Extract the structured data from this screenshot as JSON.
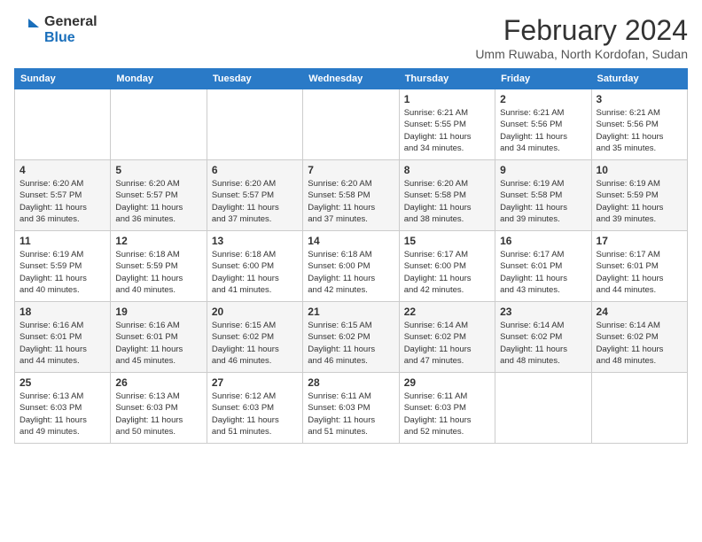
{
  "header": {
    "logo_general": "General",
    "logo_blue": "Blue",
    "month_title": "February 2024",
    "location": "Umm Ruwaba, North Kordofan, Sudan"
  },
  "weekdays": [
    "Sunday",
    "Monday",
    "Tuesday",
    "Wednesday",
    "Thursday",
    "Friday",
    "Saturday"
  ],
  "weeks": [
    [
      {
        "day": "",
        "info": ""
      },
      {
        "day": "",
        "info": ""
      },
      {
        "day": "",
        "info": ""
      },
      {
        "day": "",
        "info": ""
      },
      {
        "day": "1",
        "info": "Sunrise: 6:21 AM\nSunset: 5:55 PM\nDaylight: 11 hours\nand 34 minutes."
      },
      {
        "day": "2",
        "info": "Sunrise: 6:21 AM\nSunset: 5:56 PM\nDaylight: 11 hours\nand 34 minutes."
      },
      {
        "day": "3",
        "info": "Sunrise: 6:21 AM\nSunset: 5:56 PM\nDaylight: 11 hours\nand 35 minutes."
      }
    ],
    [
      {
        "day": "4",
        "info": "Sunrise: 6:20 AM\nSunset: 5:57 PM\nDaylight: 11 hours\nand 36 minutes."
      },
      {
        "day": "5",
        "info": "Sunrise: 6:20 AM\nSunset: 5:57 PM\nDaylight: 11 hours\nand 36 minutes."
      },
      {
        "day": "6",
        "info": "Sunrise: 6:20 AM\nSunset: 5:57 PM\nDaylight: 11 hours\nand 37 minutes."
      },
      {
        "day": "7",
        "info": "Sunrise: 6:20 AM\nSunset: 5:58 PM\nDaylight: 11 hours\nand 37 minutes."
      },
      {
        "day": "8",
        "info": "Sunrise: 6:20 AM\nSunset: 5:58 PM\nDaylight: 11 hours\nand 38 minutes."
      },
      {
        "day": "9",
        "info": "Sunrise: 6:19 AM\nSunset: 5:58 PM\nDaylight: 11 hours\nand 39 minutes."
      },
      {
        "day": "10",
        "info": "Sunrise: 6:19 AM\nSunset: 5:59 PM\nDaylight: 11 hours\nand 39 minutes."
      }
    ],
    [
      {
        "day": "11",
        "info": "Sunrise: 6:19 AM\nSunset: 5:59 PM\nDaylight: 11 hours\nand 40 minutes."
      },
      {
        "day": "12",
        "info": "Sunrise: 6:18 AM\nSunset: 5:59 PM\nDaylight: 11 hours\nand 40 minutes."
      },
      {
        "day": "13",
        "info": "Sunrise: 6:18 AM\nSunset: 6:00 PM\nDaylight: 11 hours\nand 41 minutes."
      },
      {
        "day": "14",
        "info": "Sunrise: 6:18 AM\nSunset: 6:00 PM\nDaylight: 11 hours\nand 42 minutes."
      },
      {
        "day": "15",
        "info": "Sunrise: 6:17 AM\nSunset: 6:00 PM\nDaylight: 11 hours\nand 42 minutes."
      },
      {
        "day": "16",
        "info": "Sunrise: 6:17 AM\nSunset: 6:01 PM\nDaylight: 11 hours\nand 43 minutes."
      },
      {
        "day": "17",
        "info": "Sunrise: 6:17 AM\nSunset: 6:01 PM\nDaylight: 11 hours\nand 44 minutes."
      }
    ],
    [
      {
        "day": "18",
        "info": "Sunrise: 6:16 AM\nSunset: 6:01 PM\nDaylight: 11 hours\nand 44 minutes."
      },
      {
        "day": "19",
        "info": "Sunrise: 6:16 AM\nSunset: 6:01 PM\nDaylight: 11 hours\nand 45 minutes."
      },
      {
        "day": "20",
        "info": "Sunrise: 6:15 AM\nSunset: 6:02 PM\nDaylight: 11 hours\nand 46 minutes."
      },
      {
        "day": "21",
        "info": "Sunrise: 6:15 AM\nSunset: 6:02 PM\nDaylight: 11 hours\nand 46 minutes."
      },
      {
        "day": "22",
        "info": "Sunrise: 6:14 AM\nSunset: 6:02 PM\nDaylight: 11 hours\nand 47 minutes."
      },
      {
        "day": "23",
        "info": "Sunrise: 6:14 AM\nSunset: 6:02 PM\nDaylight: 11 hours\nand 48 minutes."
      },
      {
        "day": "24",
        "info": "Sunrise: 6:14 AM\nSunset: 6:02 PM\nDaylight: 11 hours\nand 48 minutes."
      }
    ],
    [
      {
        "day": "25",
        "info": "Sunrise: 6:13 AM\nSunset: 6:03 PM\nDaylight: 11 hours\nand 49 minutes."
      },
      {
        "day": "26",
        "info": "Sunrise: 6:13 AM\nSunset: 6:03 PM\nDaylight: 11 hours\nand 50 minutes."
      },
      {
        "day": "27",
        "info": "Sunrise: 6:12 AM\nSunset: 6:03 PM\nDaylight: 11 hours\nand 51 minutes."
      },
      {
        "day": "28",
        "info": "Sunrise: 6:11 AM\nSunset: 6:03 PM\nDaylight: 11 hours\nand 51 minutes."
      },
      {
        "day": "29",
        "info": "Sunrise: 6:11 AM\nSunset: 6:03 PM\nDaylight: 11 hours\nand 52 minutes."
      },
      {
        "day": "",
        "info": ""
      },
      {
        "day": "",
        "info": ""
      }
    ]
  ]
}
